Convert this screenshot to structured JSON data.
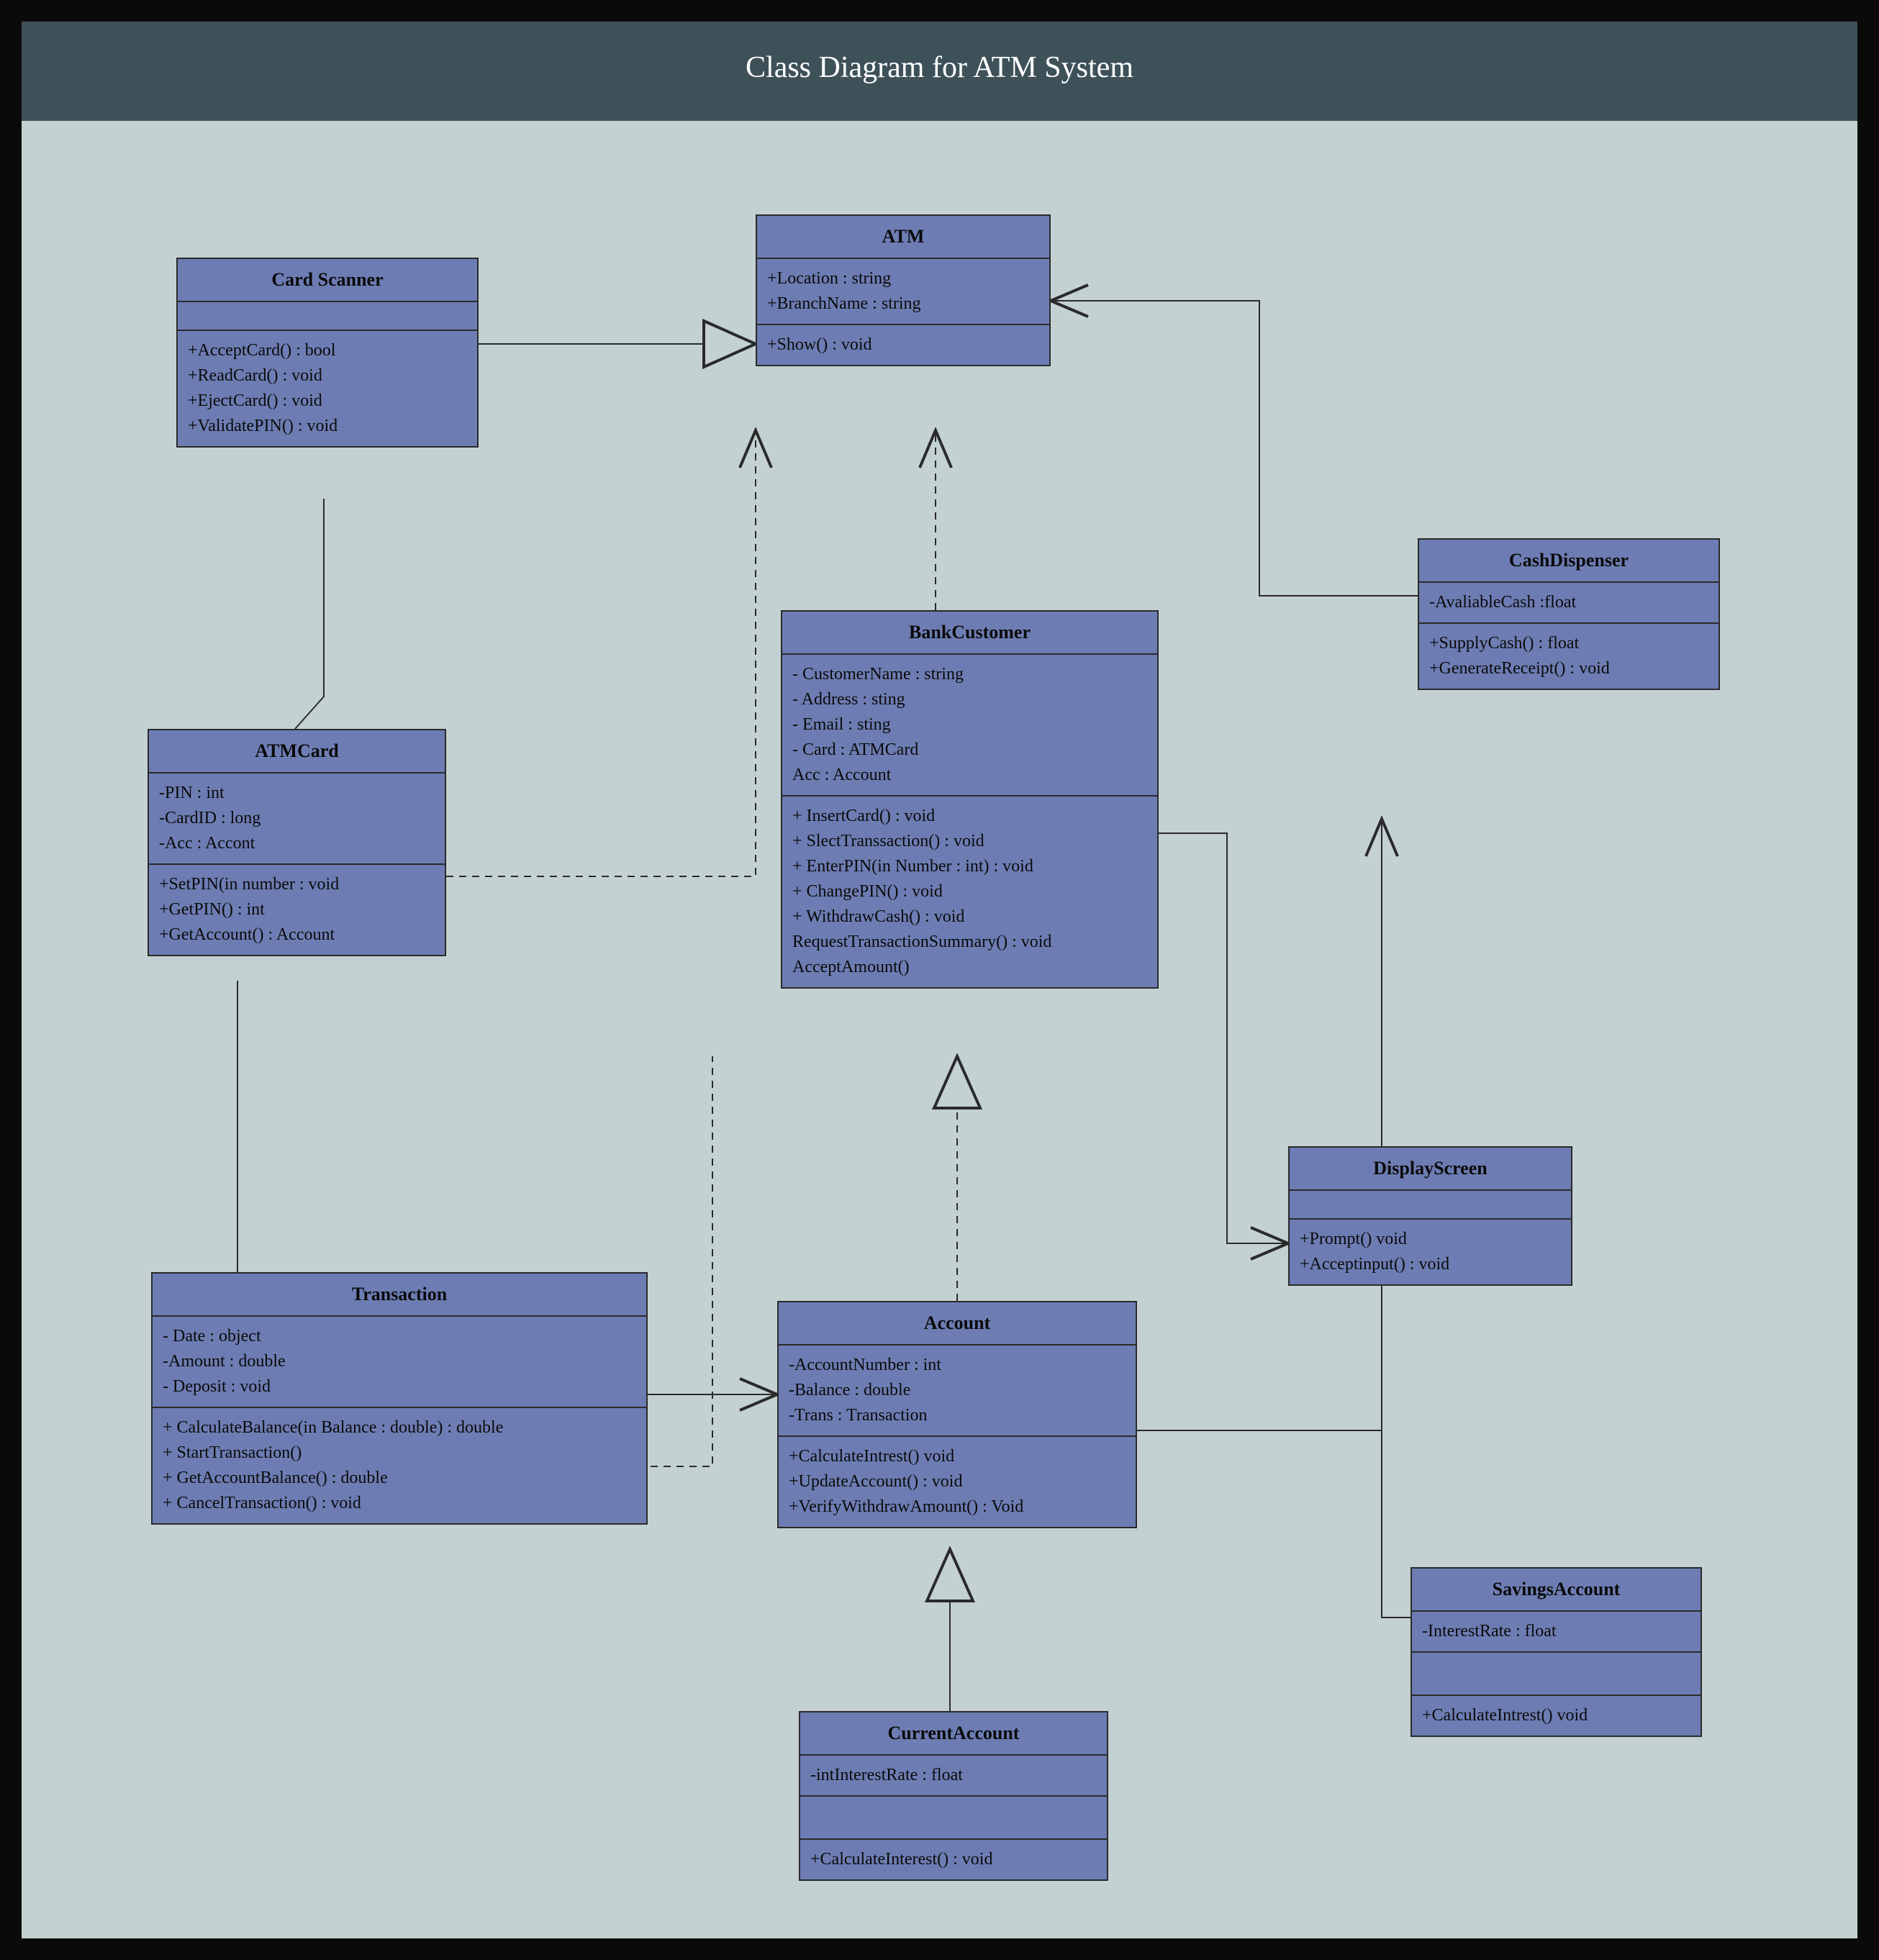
{
  "title": "Class Diagram for ATM System",
  "classes": {
    "cardScanner": {
      "name": "Card Scanner",
      "attrs": [],
      "ops": [
        "+AcceptCard() : bool",
        "+ReadCard() : void",
        "+EjectCard() : void",
        "+ValidatePIN() : void"
      ]
    },
    "atm": {
      "name": "ATM",
      "attrs": [
        "+Location : string",
        "+BranchName : string"
      ],
      "ops": [
        "+Show() : void"
      ]
    },
    "cashDispenser": {
      "name": "CashDispenser",
      "attrs": [
        "-AvaliableCash :float"
      ],
      "ops": [
        "+SupplyCash() : float",
        "+GenerateReceipt() : void"
      ]
    },
    "atmCard": {
      "name": "ATMCard",
      "attrs": [
        "-PIN : int",
        "-CardID : long",
        "-Acc : Accont"
      ],
      "ops": [
        "+SetPIN(in number : void",
        "+GetPIN() : int",
        "+GetAccount() : Account"
      ]
    },
    "bankCustomer": {
      "name": "BankCustomer",
      "attrs": [
        "- CustomerName : string",
        "- Address : sting",
        "- Email : sting",
        "- Card : ATMCard",
        "Acc : Account"
      ],
      "ops": [
        "+ InsertCard() : void",
        "+ SlectTranssaction() : void",
        "+ EnterPIN(in Number : int) : void",
        "+ ChangePIN() : void",
        "+ WithdrawCash() : void",
        "RequestTransactionSummary() : void",
        "AcceptAmount()"
      ]
    },
    "displayScreen": {
      "name": "DisplayScreen",
      "attrs": [],
      "ops": [
        "+Prompt() void",
        "+Acceptinput() : void"
      ]
    },
    "transaction": {
      "name": "Transaction",
      "attrs": [
        "- Date : object",
        "-Amount : double",
        "- Deposit : void"
      ],
      "ops": [
        "+ CalculateBalance(in Balance : double) : double",
        "+ StartTransaction()",
        "+ GetAccountBalance() : double",
        "+ CancelTransaction() : void"
      ]
    },
    "account": {
      "name": "Account",
      "attrs": [
        "-AccountNumber : int",
        "-Balance : double",
        "-Trans : Transaction"
      ],
      "ops": [
        "+CalculateIntrest() void",
        "+UpdateAccount() : void",
        "+VerifyWithdrawAmount() :  Void"
      ]
    },
    "currentAccount": {
      "name": "CurrentAccount",
      "attrs": [
        "-intInterestRate : float"
      ],
      "ops": [
        "+CalculateInterest() : void"
      ]
    },
    "savingsAccount": {
      "name": "SavingsAccount",
      "attrs": [
        "-InterestRate : float"
      ],
      "ops": [
        "+CalculateIntrest() void"
      ]
    }
  }
}
